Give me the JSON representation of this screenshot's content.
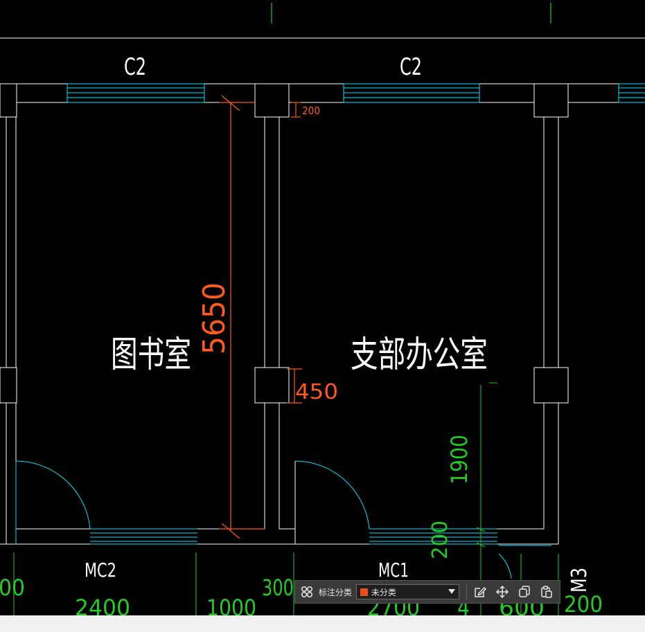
{
  "drawing": {
    "window_label_left": "C2",
    "window_label_right": "C2",
    "room_left": "图书室",
    "room_right": "支部办公室",
    "door_label_left": "MC2",
    "door_label_right": "MC1",
    "door_label_m3": "M3",
    "vertical_dim": "1900",
    "vertical_dim_small": "200",
    "bottom_dims": [
      "00",
      "2400",
      "1000",
      "300",
      "2700",
      "4",
      "600",
      "200"
    ]
  },
  "annotations": {
    "height_dim": "5650",
    "wall_thickness": "200",
    "column_width": "450"
  },
  "toolbar": {
    "category_label": "标注分类",
    "category_value": "未分类",
    "swatch_color": "#e8501a",
    "tools": [
      "grid-icon",
      "edit-icon",
      "move-icon",
      "copy-icon",
      "paste-icon"
    ]
  },
  "colors": {
    "background": "#000000",
    "walls": "#ffffff",
    "windows": "#00e5ff",
    "dimensions": "#22cc22",
    "annotation": "#ff5a1e"
  }
}
